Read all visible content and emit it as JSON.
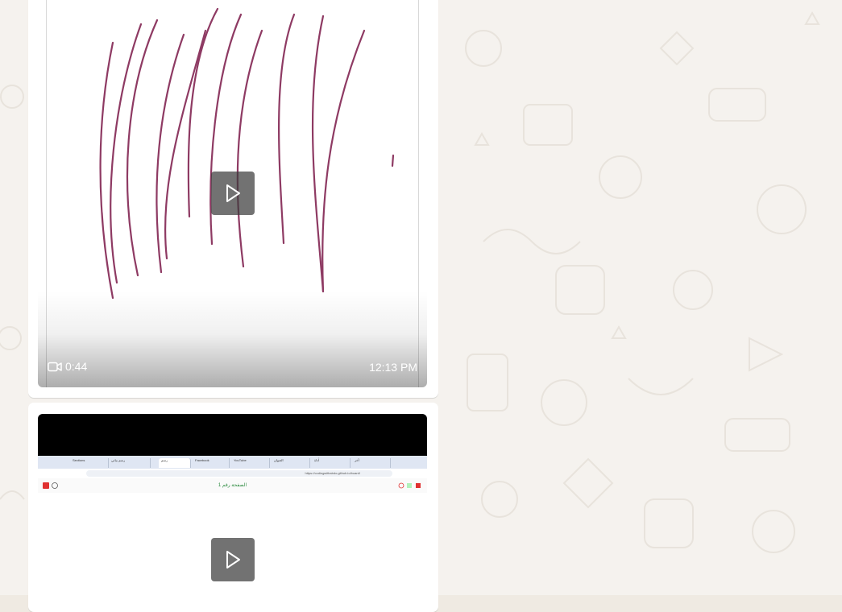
{
  "messages": [
    {
      "kind": "video",
      "duration": "0:44",
      "time": "12:13 PM",
      "thumbnail": "handwritten-pen-strokes"
    },
    {
      "kind": "video",
      "thumbnail": "browser-screen-recording",
      "browser": {
        "url": "https://codingwithabdo.github.io/board/",
        "page_title": "الصفحة رقم 1",
        "tabs": [
          "Sections",
          "Facebook",
          "رسم بياني",
          "رسم",
          "YouTube",
          "العنوان",
          "أداة",
          "آخر"
        ]
      }
    }
  ],
  "colors": {
    "ink_stroke": "#8e3a63",
    "bubble_bg": "#ffffff",
    "wallpaper_bg": "#f5f2ee",
    "page_title_color": "#2b8a3e"
  },
  "icons": {
    "play": "play-icon",
    "video_camera": "video-camera-icon"
  }
}
